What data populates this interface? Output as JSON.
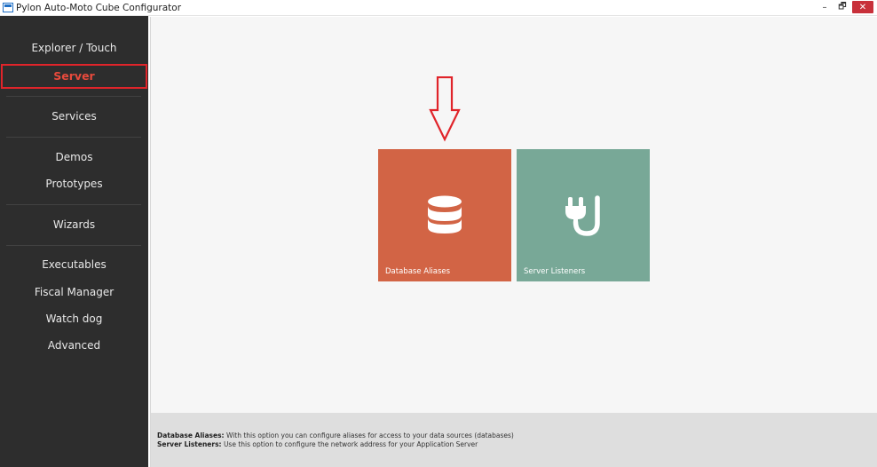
{
  "window": {
    "title": "Pylon Auto-Moto Cube Configurator",
    "minimize": "–",
    "restore": "🗗",
    "close": "✕"
  },
  "sidebar": {
    "items": [
      {
        "label": "Explorer / Touch"
      },
      {
        "label": "Server",
        "active": true
      },
      {
        "label": "Services"
      },
      {
        "label": "Demos"
      },
      {
        "label": "Prototypes"
      },
      {
        "label": "Wizards"
      },
      {
        "label": "Executables"
      },
      {
        "label": "Fiscal Manager"
      },
      {
        "label": "Watch dog"
      },
      {
        "label": "Advanced"
      }
    ]
  },
  "tiles": [
    {
      "label": "Database Aliases",
      "icon": "database-icon",
      "color": "#d26445"
    },
    {
      "label": "Server Listeners",
      "icon": "plug-icon",
      "color": "#78a897"
    }
  ],
  "footer": {
    "lines": [
      {
        "term": "Database Aliases:",
        "text": "With this option you can configure aliases for access to your data sources (databases)"
      },
      {
        "term": "Server Listeners:",
        "text": "Use this option to configure the network address for your Application Server"
      }
    ]
  },
  "colors": {
    "sidebar_bg": "#2d2d2d",
    "active_accent": "#e0242a",
    "arrow": "#e0242a"
  }
}
